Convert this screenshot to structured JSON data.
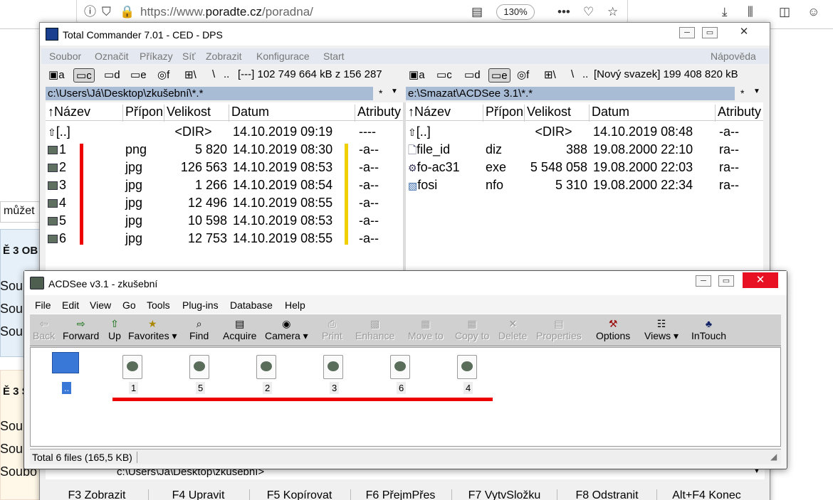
{
  "browser": {
    "url_prefix": "https://www.",
    "url_domain": "poradte.cz",
    "url_path": "/poradna/",
    "zoom": "130%"
  },
  "web": {
    "fragments": [
      "můžet",
      "Ě 3 OB",
      "Sou",
      "Sou",
      "Sou",
      "Ě 3 S",
      "Sou",
      "Sou",
      "Soubo"
    ]
  },
  "tc": {
    "title": "Total Commander 7.01 - CED - DPS",
    "menu": [
      "Soubor",
      "Označit",
      "Příkazy",
      "Síť",
      "Zobrazit",
      "Konfigurace",
      "Start"
    ],
    "help": "Nápověda",
    "left": {
      "drives": [
        "a",
        "c",
        "d",
        "e",
        "f",
        "\\",
        ".."
      ],
      "drive_info": "[---]  102 749 664 kB z 156 287",
      "path": "c:\\Users\\Já\\Desktop\\zkušební\\*.*",
      "filter": "*",
      "columns": [
        "↑Název",
        "Přípon",
        "Velikost",
        "Datum",
        "Atributy"
      ],
      "files": [
        {
          "name": "[..]",
          "ext": "",
          "size": "<DIR>",
          "date": "14.10.2019 09:19",
          "attr": "----"
        },
        {
          "name": "1",
          "ext": "png",
          "size": "5 820",
          "date": "14.10.2019 08:30",
          "attr": "-a--"
        },
        {
          "name": "2",
          "ext": "jpg",
          "size": "126 563",
          "date": "14.10.2019 08:53",
          "attr": "-a--"
        },
        {
          "name": "3",
          "ext": "jpg",
          "size": "1 266",
          "date": "14.10.2019 08:54",
          "attr": "-a--"
        },
        {
          "name": "4",
          "ext": "jpg",
          "size": "12 496",
          "date": "14.10.2019 08:55",
          "attr": "-a--"
        },
        {
          "name": "5",
          "ext": "jpg",
          "size": "10 598",
          "date": "14.10.2019 08:53",
          "attr": "-a--"
        },
        {
          "name": "6",
          "ext": "jpg",
          "size": "12 753",
          "date": "14.10.2019 08:55",
          "attr": "-a--"
        }
      ]
    },
    "right": {
      "drives": [
        "a",
        "c",
        "d",
        "e",
        "f",
        "\\",
        ".."
      ],
      "drive_info": "[Nový svazek]  199 408 820 kB",
      "path": "e:\\Smazat\\ACDSee 3.1\\*.*",
      "filter": "*",
      "columns": [
        "↑Název",
        "Přípon",
        "Velikost",
        "Datum",
        "Atributy"
      ],
      "files": [
        {
          "name": "[..]",
          "ext": "",
          "size": "<DIR>",
          "date": "14.10.2019 08:48",
          "attr": "-a--"
        },
        {
          "name": "file_id",
          "ext": "diz",
          "size": "388",
          "date": "19.08.2000 22:10",
          "attr": "ra--"
        },
        {
          "name": "fo-ac31",
          "ext": "exe",
          "size": "5 548 058",
          "date": "19.08.2000 22:03",
          "attr": "ra--"
        },
        {
          "name": "fosi",
          "ext": "nfo",
          "size": "5 310",
          "date": "19.08.2000 22:34",
          "attr": "ra--"
        }
      ]
    },
    "cmdline": "c:\\Users\\Já\\Desktop\\zkušební>",
    "fkeys": [
      "F3 Zobrazit",
      "F4 Upravit",
      "F5 Kopírovat",
      "F6 PřejmPřes",
      "F7 VytvSložku",
      "F8 Odstranit",
      "Alt+F4 Konec"
    ]
  },
  "acd": {
    "title": "ACDSee v3.1 - zkušební",
    "menu": [
      "File",
      "Edit",
      "View",
      "Go",
      "Tools",
      "Plug-ins",
      "Database",
      "Help"
    ],
    "toolbar": [
      {
        "label": "Back",
        "enabled": false
      },
      {
        "label": "Forward",
        "enabled": true
      },
      {
        "label": "Up",
        "enabled": true
      },
      {
        "label": "Favorites",
        "enabled": true
      },
      {
        "label": "Find",
        "enabled": true
      },
      {
        "label": "Acquire",
        "enabled": true
      },
      {
        "label": "Camera",
        "enabled": true
      },
      {
        "label": "Print",
        "enabled": false
      },
      {
        "label": "Enhance",
        "enabled": false
      },
      {
        "label": "Move to",
        "enabled": false
      },
      {
        "label": "Copy to",
        "enabled": false
      },
      {
        "label": "Delete",
        "enabled": false
      },
      {
        "label": "Properties",
        "enabled": false
      },
      {
        "label": "Options",
        "enabled": true
      },
      {
        "label": "Views",
        "enabled": true
      },
      {
        "label": "InTouch",
        "enabled": true
      }
    ],
    "thumbnails": [
      "..",
      "1",
      "5",
      "2",
      "3",
      "6",
      "4"
    ],
    "status": "Total 6 files (165,5 KB)"
  },
  "colors": {
    "highlight_red": "#e00000",
    "highlight_yellow": "#f0d000",
    "path_bar": "#a9bcd6"
  }
}
